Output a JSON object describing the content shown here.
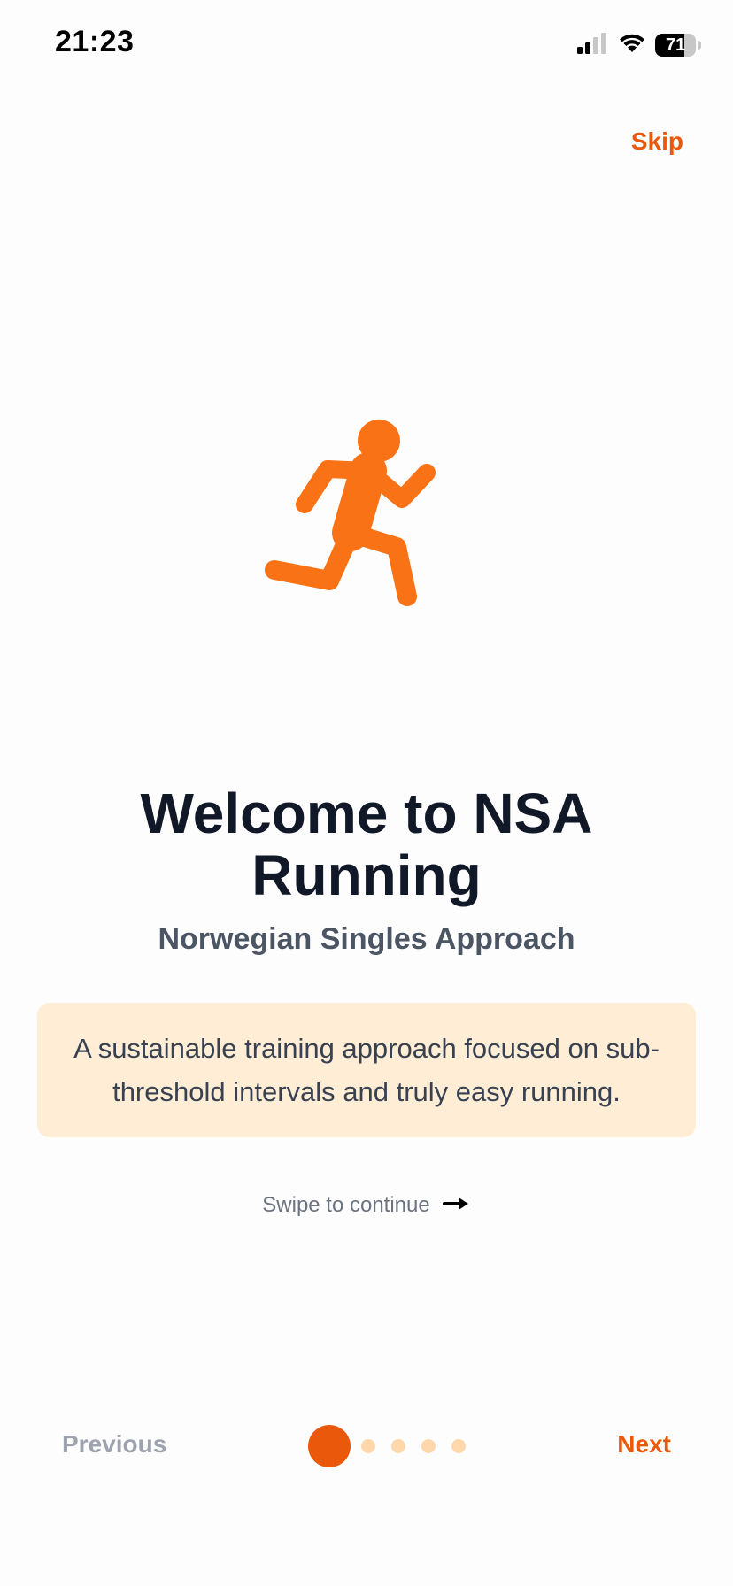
{
  "status_bar": {
    "time": "21:23",
    "battery_level": "71",
    "icons": [
      "cellular-signal-icon",
      "wifi-icon",
      "battery-icon"
    ]
  },
  "skip_label": "Skip",
  "hero_icon": "running-person-icon",
  "title": "Welcome to NSA Running",
  "subtitle": "Norwegian Singles Approach",
  "info_text": "A sustainable training approach focused on sub-threshold intervals and truly easy running.",
  "swipe_hint": "Swipe to continue",
  "swipe_icon": "arrow-right-icon",
  "nav": {
    "previous_label": "Previous",
    "next_label": "Next",
    "page_count": 5,
    "current_page": 1
  },
  "colors": {
    "accent": "#EA580C",
    "hero": "#F97316",
    "card_bg": "#FFEDD5",
    "dot_inactive": "#FED7AA",
    "title": "#111827",
    "subtitle": "#4B5563",
    "disabled": "#9CA3AF"
  }
}
